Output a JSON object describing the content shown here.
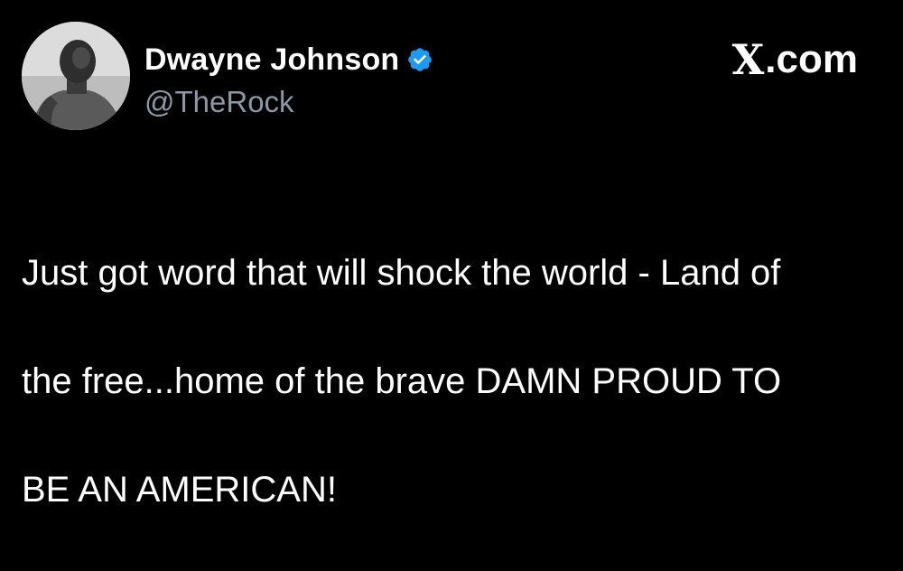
{
  "author": {
    "display_name": "Dwayne Johnson",
    "handle": "@TheRock",
    "verified": true,
    "avatar_icon": "profile-photo"
  },
  "brand": {
    "mark": "X",
    "domain": ".com"
  },
  "tweet": {
    "lines": [
      "Just got word that will shock the world - Land of",
      "the free...home of the brave DAMN PROUD TO",
      "BE AN AMERICAN!"
    ]
  },
  "colors": {
    "background": "#000000",
    "text_primary": "#ffffff",
    "text_secondary": "#8b98a5",
    "verified_badge": "#1d9bf0"
  }
}
